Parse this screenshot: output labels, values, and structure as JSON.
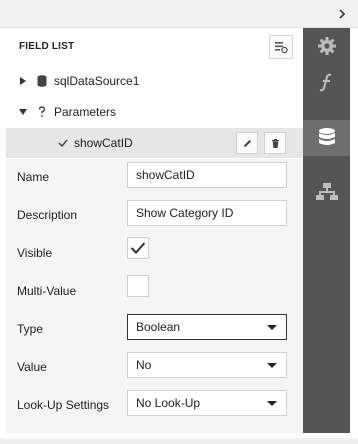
{
  "field_list": {
    "title": "FIELD LIST",
    "tree": [
      {
        "label": "sqlDataSource1",
        "icon": "database-icon",
        "expanded": false
      },
      {
        "label": "Parameters",
        "icon": "question-icon",
        "expanded": true
      }
    ],
    "selected_parameter": "showCatID"
  },
  "properties": [
    {
      "label": "Name",
      "kind": "input",
      "value": "showCatID"
    },
    {
      "label": "Description",
      "kind": "input",
      "value": "Show Category ID"
    },
    {
      "label": "Visible",
      "kind": "checkbox",
      "checked": true
    },
    {
      "label": "Multi-Value",
      "kind": "checkbox",
      "checked": false
    },
    {
      "label": "Type",
      "kind": "select",
      "value": "Boolean"
    },
    {
      "label": "Value",
      "kind": "select",
      "value": "No"
    },
    {
      "label": "Look-Up Settings",
      "kind": "select",
      "value": "No Look-Up"
    }
  ],
  "side_tabs": [
    {
      "icon": "gear-icon",
      "active": false
    },
    {
      "icon": "function-icon",
      "active": false
    },
    {
      "icon": "database-icon",
      "active": true
    },
    {
      "icon": "hierarchy-icon",
      "active": false
    }
  ],
  "colors": {
    "tab_strip": "#555555",
    "tab_active": "#6e6e6e",
    "selected_row": "#e6e6e6",
    "properties_bg": "#f5f5f5"
  }
}
